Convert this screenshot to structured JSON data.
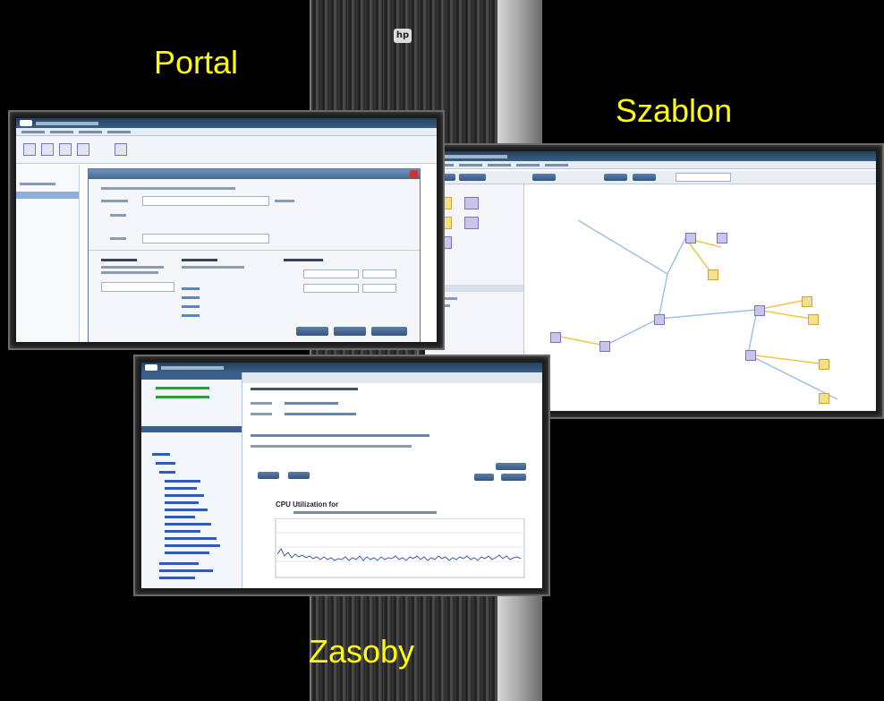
{
  "captions": {
    "portal": "Portal",
    "szablon": "Szablon",
    "zasoby": "Zasoby"
  },
  "colors": {
    "caption": "#ffff00",
    "background": "#000000"
  },
  "icons": {
    "rack_logo": "hp-logo-icon"
  },
  "portal_screen": {
    "dialog_title": "",
    "buttons": [
      "",
      "",
      ""
    ]
  },
  "zasoby_screen": {
    "chart_title": "CPU Utilization for"
  }
}
